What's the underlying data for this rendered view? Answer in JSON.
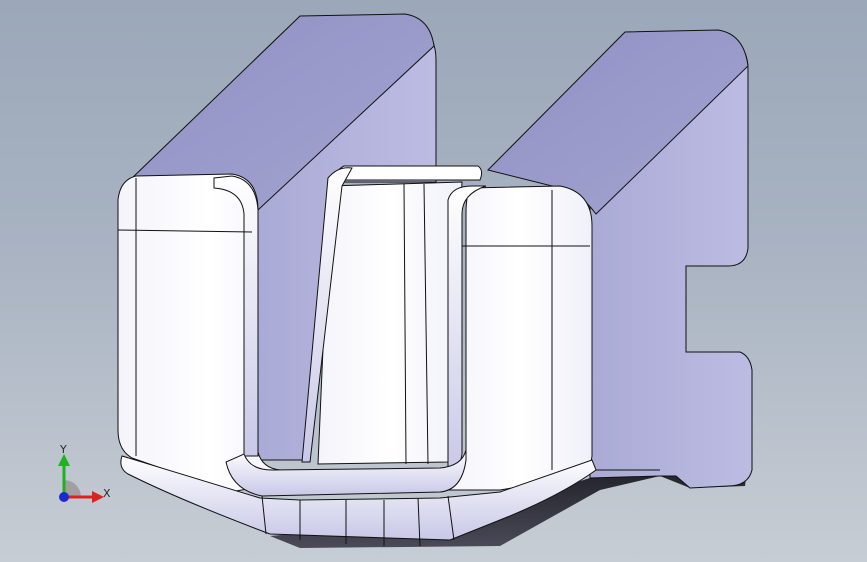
{
  "viewport": {
    "background_top": "#9ba8b9",
    "background_bottom": "#c7cdd4"
  },
  "model": {
    "face_front_color": "#ffffff",
    "face_side_color": "#b4b4dc",
    "face_top_color": "#9a9acb",
    "edge_color": "#111111",
    "shadow_color": "#2b2b35"
  },
  "triad": {
    "x_label": "X",
    "y_label": "Y",
    "x_color": "#e02020",
    "y_color": "#20b020",
    "z_color": "#1a2ad0"
  }
}
